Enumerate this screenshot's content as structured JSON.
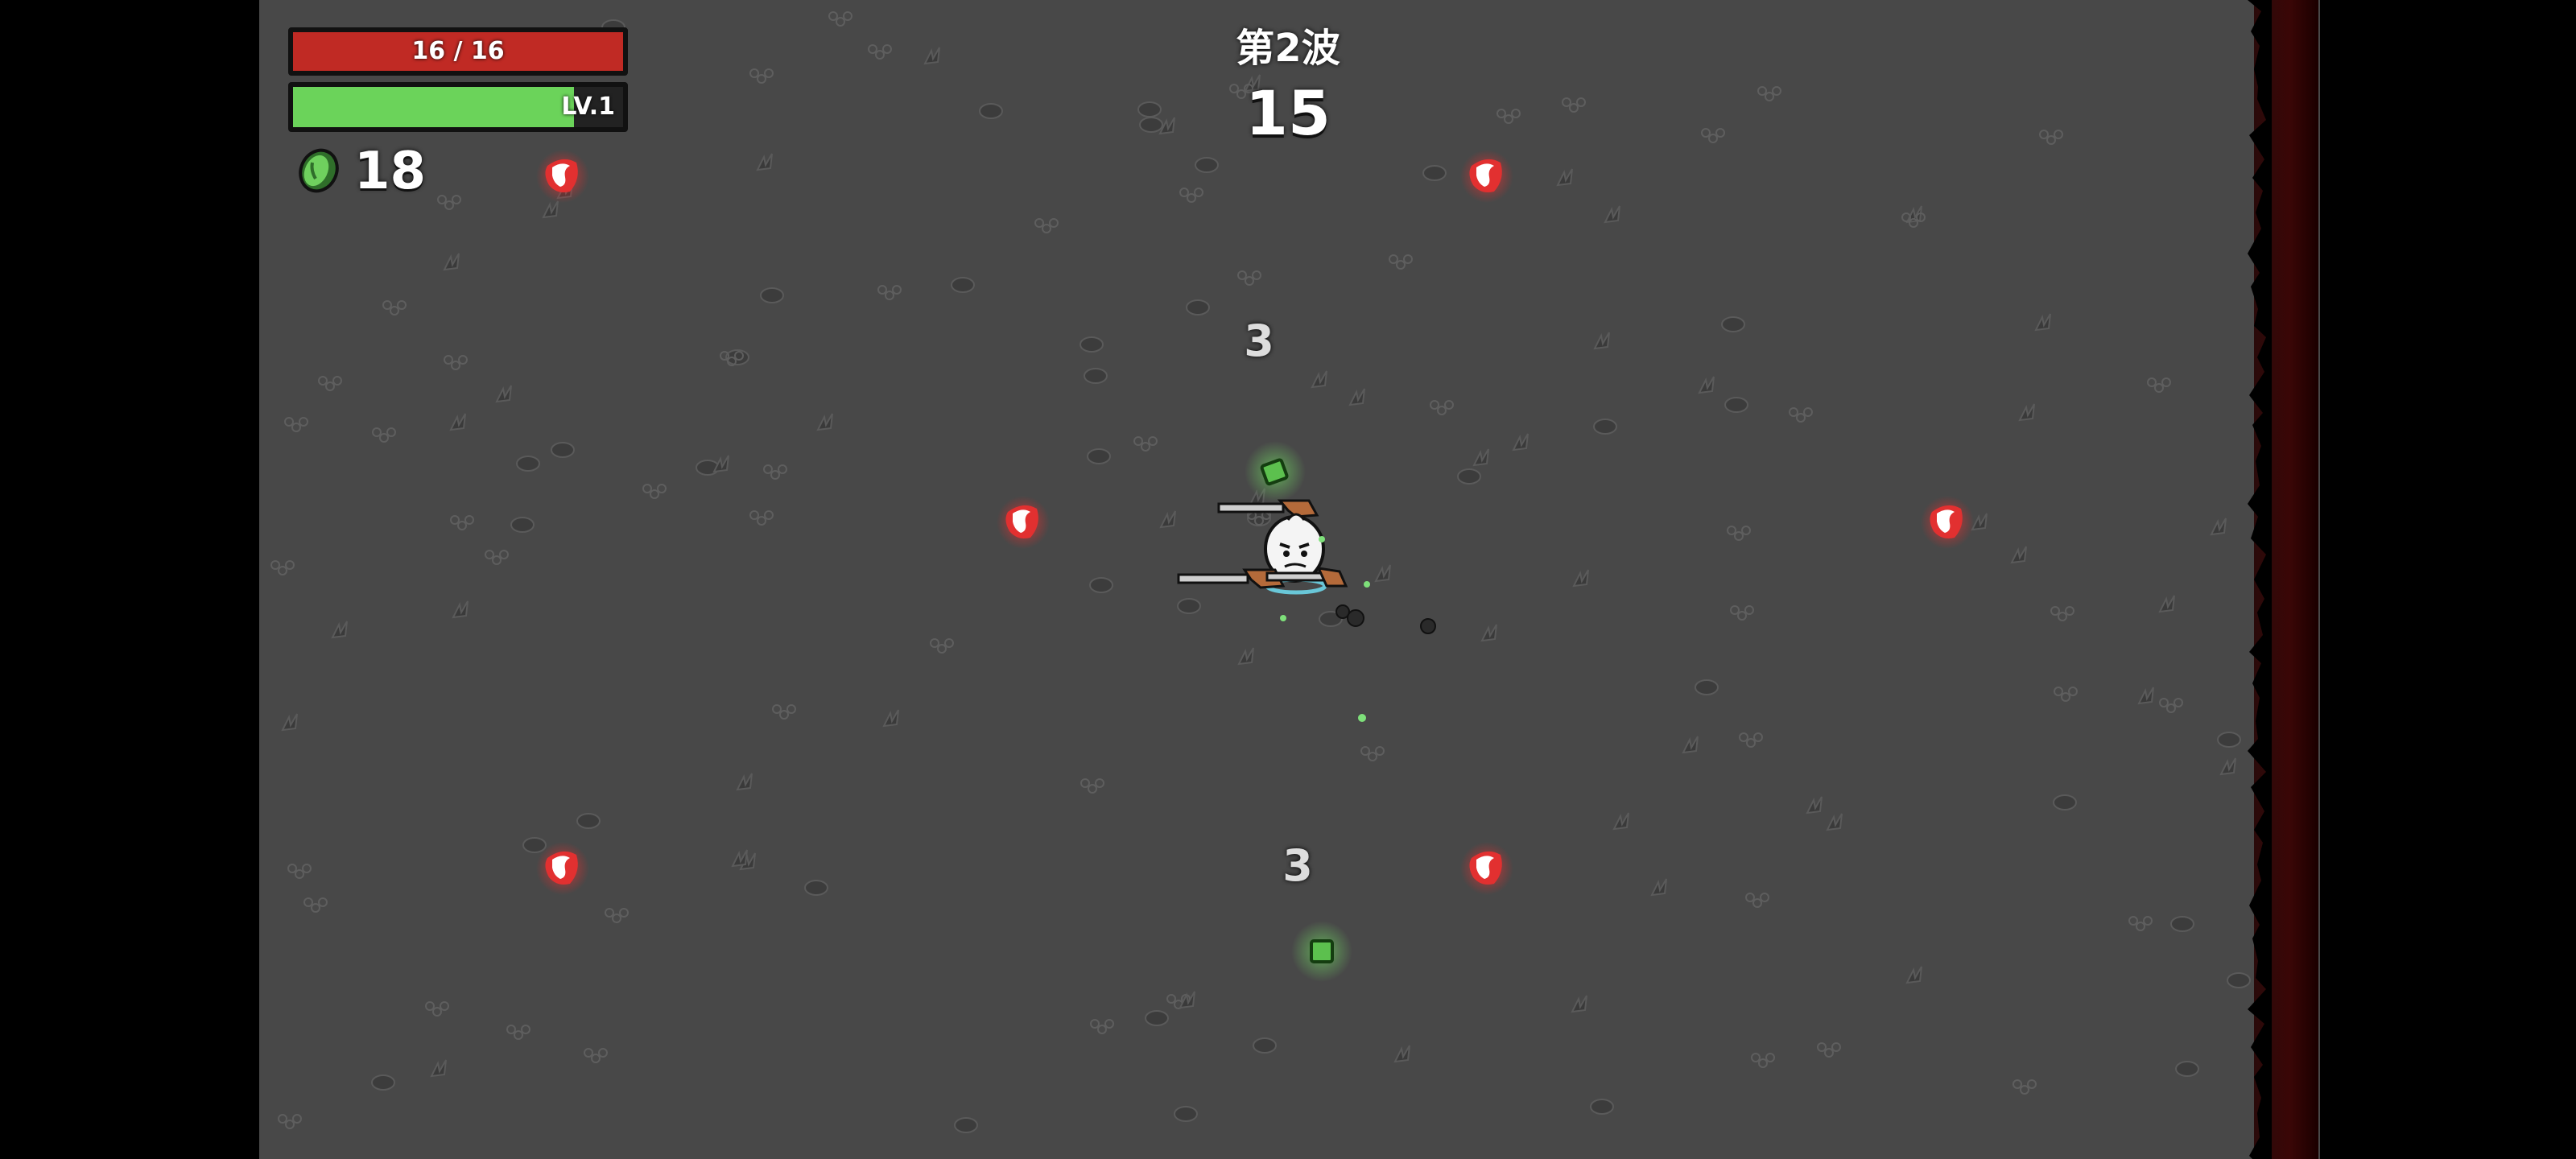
{
  "hud": {
    "hp_text": "16 / 16",
    "hp_fraction": 1.0,
    "level_text": "LV.1",
    "xp_fraction": 0.85,
    "materials_count": "18"
  },
  "wave": {
    "label": "第2波",
    "timer": "15"
  },
  "floating_numbers": [
    "3",
    "3"
  ],
  "colors": {
    "hp": "#c02a24",
    "xp": "#6bd35a",
    "spawn_marker": "#e23030",
    "material": "#5cc04e",
    "ground": "#484848"
  },
  "icons": {
    "materials": "green-coin-icon",
    "spawn": "enemy-spawn-marker-icon",
    "player": "potato-character-icon"
  }
}
